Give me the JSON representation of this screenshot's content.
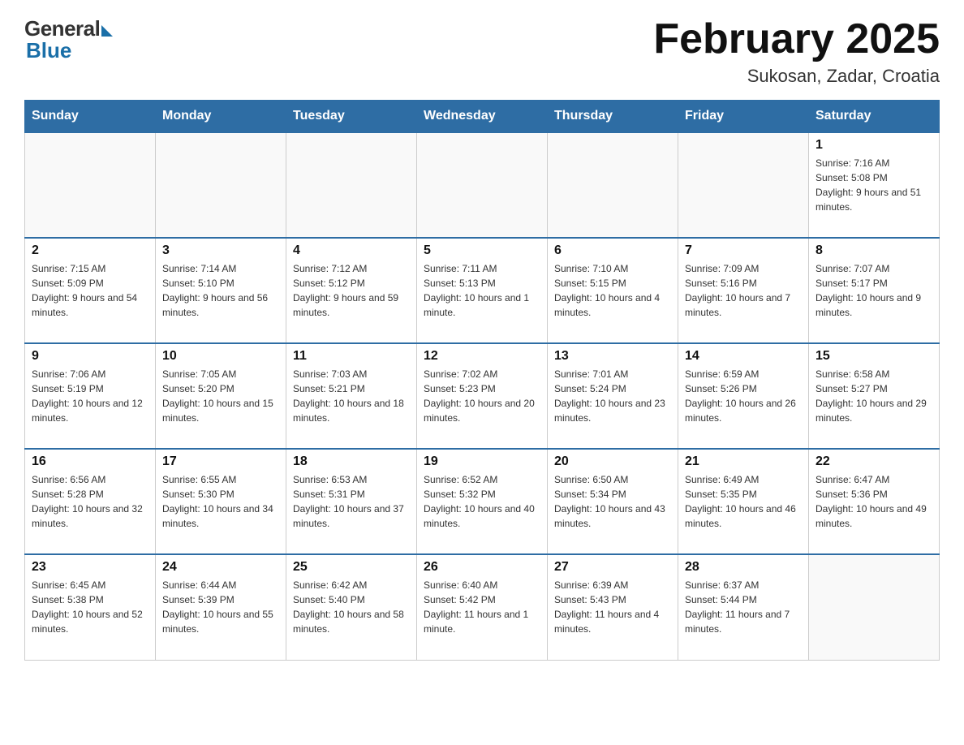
{
  "header": {
    "logo_general": "General",
    "logo_blue": "Blue",
    "month_title": "February 2025",
    "location": "Sukosan, Zadar, Croatia"
  },
  "days_of_week": [
    "Sunday",
    "Monday",
    "Tuesday",
    "Wednesday",
    "Thursday",
    "Friday",
    "Saturday"
  ],
  "weeks": [
    [
      {
        "day": "",
        "info": ""
      },
      {
        "day": "",
        "info": ""
      },
      {
        "day": "",
        "info": ""
      },
      {
        "day": "",
        "info": ""
      },
      {
        "day": "",
        "info": ""
      },
      {
        "day": "",
        "info": ""
      },
      {
        "day": "1",
        "info": "Sunrise: 7:16 AM\nSunset: 5:08 PM\nDaylight: 9 hours and 51 minutes."
      }
    ],
    [
      {
        "day": "2",
        "info": "Sunrise: 7:15 AM\nSunset: 5:09 PM\nDaylight: 9 hours and 54 minutes."
      },
      {
        "day": "3",
        "info": "Sunrise: 7:14 AM\nSunset: 5:10 PM\nDaylight: 9 hours and 56 minutes."
      },
      {
        "day": "4",
        "info": "Sunrise: 7:12 AM\nSunset: 5:12 PM\nDaylight: 9 hours and 59 minutes."
      },
      {
        "day": "5",
        "info": "Sunrise: 7:11 AM\nSunset: 5:13 PM\nDaylight: 10 hours and 1 minute."
      },
      {
        "day": "6",
        "info": "Sunrise: 7:10 AM\nSunset: 5:15 PM\nDaylight: 10 hours and 4 minutes."
      },
      {
        "day": "7",
        "info": "Sunrise: 7:09 AM\nSunset: 5:16 PM\nDaylight: 10 hours and 7 minutes."
      },
      {
        "day": "8",
        "info": "Sunrise: 7:07 AM\nSunset: 5:17 PM\nDaylight: 10 hours and 9 minutes."
      }
    ],
    [
      {
        "day": "9",
        "info": "Sunrise: 7:06 AM\nSunset: 5:19 PM\nDaylight: 10 hours and 12 minutes."
      },
      {
        "day": "10",
        "info": "Sunrise: 7:05 AM\nSunset: 5:20 PM\nDaylight: 10 hours and 15 minutes."
      },
      {
        "day": "11",
        "info": "Sunrise: 7:03 AM\nSunset: 5:21 PM\nDaylight: 10 hours and 18 minutes."
      },
      {
        "day": "12",
        "info": "Sunrise: 7:02 AM\nSunset: 5:23 PM\nDaylight: 10 hours and 20 minutes."
      },
      {
        "day": "13",
        "info": "Sunrise: 7:01 AM\nSunset: 5:24 PM\nDaylight: 10 hours and 23 minutes."
      },
      {
        "day": "14",
        "info": "Sunrise: 6:59 AM\nSunset: 5:26 PM\nDaylight: 10 hours and 26 minutes."
      },
      {
        "day": "15",
        "info": "Sunrise: 6:58 AM\nSunset: 5:27 PM\nDaylight: 10 hours and 29 minutes."
      }
    ],
    [
      {
        "day": "16",
        "info": "Sunrise: 6:56 AM\nSunset: 5:28 PM\nDaylight: 10 hours and 32 minutes."
      },
      {
        "day": "17",
        "info": "Sunrise: 6:55 AM\nSunset: 5:30 PM\nDaylight: 10 hours and 34 minutes."
      },
      {
        "day": "18",
        "info": "Sunrise: 6:53 AM\nSunset: 5:31 PM\nDaylight: 10 hours and 37 minutes."
      },
      {
        "day": "19",
        "info": "Sunrise: 6:52 AM\nSunset: 5:32 PM\nDaylight: 10 hours and 40 minutes."
      },
      {
        "day": "20",
        "info": "Sunrise: 6:50 AM\nSunset: 5:34 PM\nDaylight: 10 hours and 43 minutes."
      },
      {
        "day": "21",
        "info": "Sunrise: 6:49 AM\nSunset: 5:35 PM\nDaylight: 10 hours and 46 minutes."
      },
      {
        "day": "22",
        "info": "Sunrise: 6:47 AM\nSunset: 5:36 PM\nDaylight: 10 hours and 49 minutes."
      }
    ],
    [
      {
        "day": "23",
        "info": "Sunrise: 6:45 AM\nSunset: 5:38 PM\nDaylight: 10 hours and 52 minutes."
      },
      {
        "day": "24",
        "info": "Sunrise: 6:44 AM\nSunset: 5:39 PM\nDaylight: 10 hours and 55 minutes."
      },
      {
        "day": "25",
        "info": "Sunrise: 6:42 AM\nSunset: 5:40 PM\nDaylight: 10 hours and 58 minutes."
      },
      {
        "day": "26",
        "info": "Sunrise: 6:40 AM\nSunset: 5:42 PM\nDaylight: 11 hours and 1 minute."
      },
      {
        "day": "27",
        "info": "Sunrise: 6:39 AM\nSunset: 5:43 PM\nDaylight: 11 hours and 4 minutes."
      },
      {
        "day": "28",
        "info": "Sunrise: 6:37 AM\nSunset: 5:44 PM\nDaylight: 11 hours and 7 minutes."
      },
      {
        "day": "",
        "info": ""
      }
    ]
  ]
}
